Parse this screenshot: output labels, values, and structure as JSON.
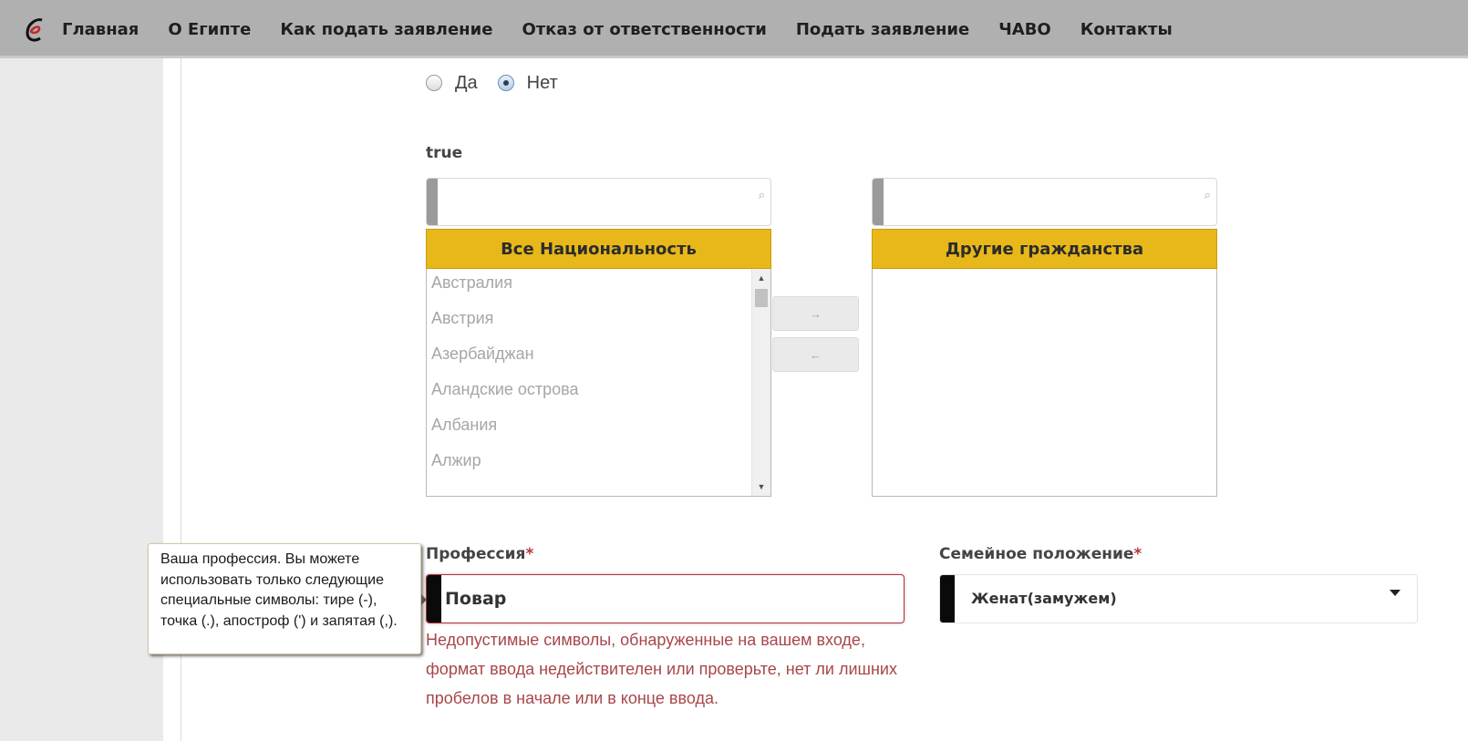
{
  "nav": {
    "items": [
      "Главная",
      "О Египте",
      "Как подать заявление",
      "Отказ от ответственности",
      "Подать заявление",
      "ЧАВО",
      "Контакты"
    ]
  },
  "radio": {
    "yes_label": "Да",
    "no_label": "Нет",
    "selected": "Нет"
  },
  "field_label": "true",
  "dual_list": {
    "left": {
      "search_placeholder": "",
      "header": "Все Национальность",
      "items": [
        "Австралия",
        "Австрия",
        "Азербайджан",
        "Аландские острова",
        "Албания",
        "Алжир"
      ]
    },
    "right": {
      "search_placeholder": "",
      "header": "Другие гражданства",
      "items": []
    },
    "move_right_label": "→",
    "move_left_label": "←"
  },
  "profession": {
    "label": "Профессия",
    "required_mark": "*",
    "value": "Повар",
    "error": "Недопустимые символы, обнаруженные на вашем входе, формат ввода недействителен или проверьте, нет ли лишних пробелов в начале или в конце ввода.",
    "tooltip": "Ваша профессия. Вы можете использовать только следующие специальные символы: тире (-), точка (.), апостроф (') и запятая (,)."
  },
  "marital": {
    "label": "Семейное положение",
    "required_mark": "*",
    "value": "Женат(замужем)"
  },
  "colors": {
    "nav_bg": "#b0b0b0",
    "list_header": "#e8b81a",
    "error": "#a8353a"
  }
}
